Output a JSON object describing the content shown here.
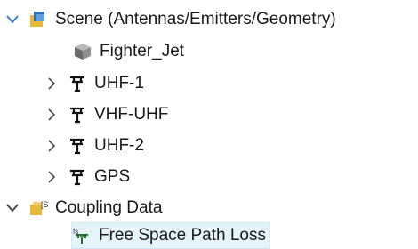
{
  "tree": {
    "scene": {
      "label": "Scene (Antennas/Emitters/Geometry)",
      "expanded": true,
      "children": [
        {
          "label": "Fighter_Jet",
          "icon": "geometry-cube-icon"
        },
        {
          "label": "UHF-1",
          "icon": "antenna-icon",
          "expanded": false
        },
        {
          "label": "VHF-UHF",
          "icon": "antenna-icon",
          "expanded": false
        },
        {
          "label": "UHF-2",
          "icon": "antenna-icon",
          "expanded": false
        },
        {
          "label": "GPS",
          "icon": "antenna-icon",
          "expanded": false
        }
      ]
    },
    "coupling": {
      "label": "Coupling Data",
      "expanded": true,
      "children": [
        {
          "label": "Free Space Path Loss",
          "icon": "path-loss-icon",
          "selected": true
        }
      ]
    }
  },
  "colors": {
    "chevron": "#4a4a4a",
    "folder_yellow": "#e8b83a",
    "folder_blue": "#2f6fb3",
    "selection": "#e5f3fb"
  }
}
